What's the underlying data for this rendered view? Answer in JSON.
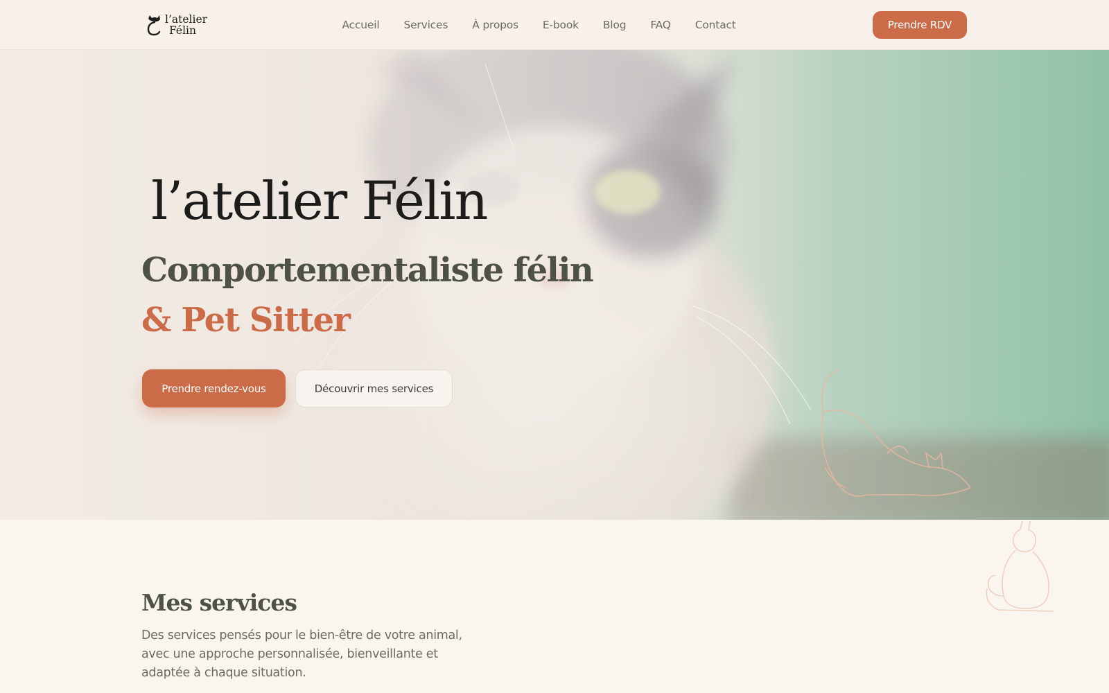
{
  "header": {
    "logo": {
      "line1": "l’atelier",
      "line2": "Félin"
    },
    "nav": [
      {
        "label": "Accueil"
      },
      {
        "label": "Services"
      },
      {
        "label": "À propos"
      },
      {
        "label": "E-book"
      },
      {
        "label": "Blog"
      },
      {
        "label": "FAQ"
      },
      {
        "label": "Contact"
      }
    ],
    "cta_label": "Prendre RDV"
  },
  "hero": {
    "brand_title": "l’atelier Félin",
    "subtitle_line1": "Comportementaliste félin",
    "subtitle_line2": "& Pet Sitter",
    "cta_primary": "Prendre rendez-vous",
    "cta_secondary": "Découvrir mes services"
  },
  "services": {
    "title": "Mes services",
    "description": "Des services pensés pour le bien-être de votre animal, avec une approche personnalisée, bienveillante et adaptée à chaque situation."
  },
  "colors": {
    "accent": "#cc6b47",
    "background": "#faf6ef",
    "heading": "#4d5148",
    "hero_green": "#8fc1a7"
  },
  "icons": [
    "cat-logo-icon",
    "cat-outline-decoration",
    "sitting-cat-decoration"
  ]
}
